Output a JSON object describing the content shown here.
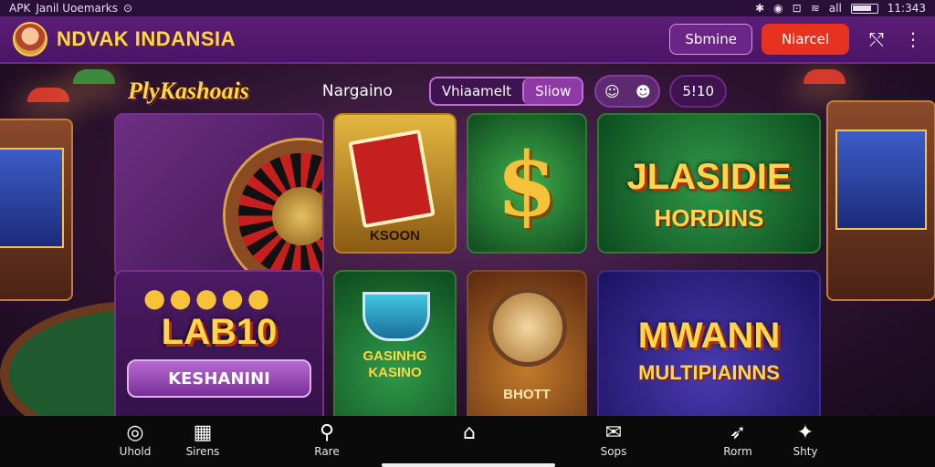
{
  "status_bar": {
    "left_text": "APK",
    "carrier_text": "Jаnil Uoemarks",
    "time": "11:343",
    "signal_label": "all"
  },
  "header": {
    "brand": "NDVAK INDANSIA",
    "outline_button": "Sbmine",
    "primary_button": "Niarcel",
    "icons": [
      "share-icon",
      "more-vertical-icon"
    ]
  },
  "toolbar": {
    "section_title": "PlyKashoais",
    "nav_label": "Nargaino",
    "segment": [
      "Vhiaamelt",
      "Sliow"
    ],
    "count": "5!10"
  },
  "tiles": {
    "book_label": "KSOON",
    "classic_title": "JLASIDIE",
    "classic_subtitle": "HORDINS",
    "lab_title": "LAB10",
    "lab_button": "KESHANINI",
    "casino_label": "GASINHG KASINO",
    "compass_label": "BHOTT",
    "multi_title": "MWANN",
    "multi_subtitle": "MULTIPIAINNS"
  },
  "bottom_nav": [
    {
      "label": "Uhold",
      "icon": "coin-icon"
    },
    {
      "label": "Sirens",
      "icon": "gift-icon"
    },
    {
      "label": "Rare",
      "icon": "search-icon"
    },
    {
      "label": "",
      "icon": "home-icon"
    },
    {
      "label": "Sops",
      "icon": "chat-icon"
    },
    {
      "label": "Rorm",
      "icon": "rocket-icon"
    },
    {
      "label": "Shty",
      "icon": "user-icon"
    }
  ],
  "colors": {
    "accent": "#ffd54a",
    "header_bg": "#5c1d78",
    "primary_button": "#e6321e"
  }
}
